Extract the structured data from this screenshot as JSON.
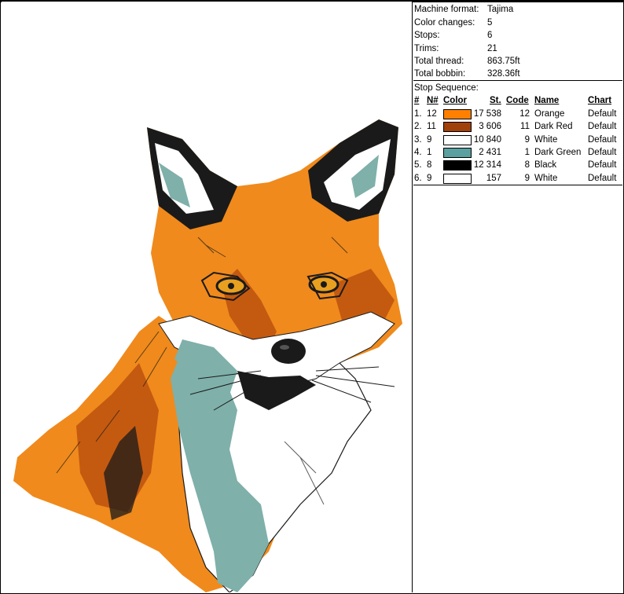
{
  "info": [
    {
      "label": "Machine format:",
      "value": "Tajima"
    },
    {
      "label": "Color changes:",
      "value": "5"
    },
    {
      "label": "Stops:",
      "value": "6"
    },
    {
      "label": "Trims:",
      "value": "21"
    },
    {
      "label": "Total thread:",
      "value": "863.75ft"
    },
    {
      "label": "Total bobbin:",
      "value": "328.36ft"
    }
  ],
  "sequence": {
    "title": "Stop Sequence:",
    "headers": {
      "idx": "#",
      "n": "N#",
      "color": "Color",
      "st": "St.",
      "code": "Code",
      "name": "Name",
      "chart": "Chart"
    },
    "rows": [
      {
        "idx": "1.",
        "n": "12",
        "color": "#ff8000",
        "st": "17 538",
        "code": "12",
        "name": "Orange",
        "chart": "Default"
      },
      {
        "idx": "2.",
        "n": "11",
        "color": "#a0400a",
        "st": "3 606",
        "code": "11",
        "name": "Dark Red",
        "chart": "Default"
      },
      {
        "idx": "3.",
        "n": "9",
        "color": "#ffffff",
        "st": "10 840",
        "code": "9",
        "name": "White",
        "chart": "Default"
      },
      {
        "idx": "4.",
        "n": "1",
        "color": "#5aa0a0",
        "st": "2 431",
        "code": "1",
        "name": "Dark Green",
        "chart": "Default"
      },
      {
        "idx": "5.",
        "n": "8",
        "color": "#000000",
        "st": "12 314",
        "code": "8",
        "name": "Black",
        "chart": "Default"
      },
      {
        "idx": "6.",
        "n": "9",
        "color": "#ffffff",
        "st": "157",
        "code": "9",
        "name": "White",
        "chart": "Default"
      }
    ]
  },
  "design": {
    "subject": "fox-head-embroidery",
    "colors": {
      "orange": "#f08a1c",
      "dark_orange": "#c45a10",
      "dark_red": "#a0400a",
      "white": "#ffffff",
      "teal": "#7fb0aa",
      "black": "#1a1a1a"
    }
  }
}
